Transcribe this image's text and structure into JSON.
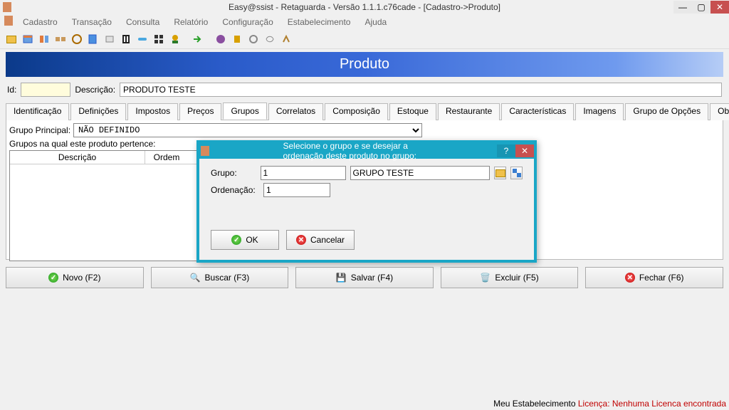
{
  "window": {
    "title": "Easy@ssist - Retaguarda - Versão 1.1.1.c76cade - [Cadastro->Produto]"
  },
  "menu": {
    "items": [
      "Cadastro",
      "Transação",
      "Consulta",
      "Relatório",
      "Configuração",
      "Estabelecimento",
      "Ajuda"
    ]
  },
  "page": {
    "title": "Produto"
  },
  "form": {
    "id_label": "Id:",
    "id_value": "",
    "desc_label": "Descrição:",
    "desc_value": "PRODUTO TESTE"
  },
  "tabs": [
    "Identificação",
    "Definições",
    "Impostos",
    "Preços",
    "Grupos",
    "Correlatos",
    "Composição",
    "Estoque",
    "Restaurante",
    "Características",
    "Imagens",
    "Grupo de Opções",
    "Observações (itens)"
  ],
  "grupos": {
    "principal_label": "Grupo Principal:",
    "principal_value": "NÃO DEFINIDO",
    "belong_label": "Grupos na qual este produto pertence:",
    "list_headers": {
      "desc": "Descrição",
      "ordem": "Ordem"
    }
  },
  "modal": {
    "title": "Selecione o grupo e se desejar a ordenação deste produto no grupo:",
    "grupo_label": "Grupo:",
    "grupo_code": "1",
    "grupo_name": "GRUPO TESTE",
    "ordenacao_label": "Ordenação:",
    "ordenacao_value": "1",
    "ok": "OK",
    "cancel": "Cancelar"
  },
  "footer_btns": {
    "novo": "Novo (F2)",
    "buscar": "Buscar (F3)",
    "salvar": "Salvar (F4)",
    "excluir": "Excluir (F5)",
    "fechar": "Fechar (F6)"
  },
  "status": {
    "prefix": "Meu Estabelecimento ",
    "licenca": "Licença: Nenhuma Licenca encontrada"
  }
}
